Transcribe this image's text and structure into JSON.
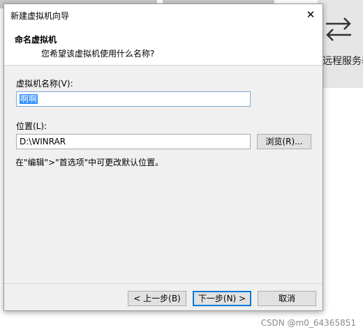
{
  "dialog": {
    "title": "新建虚拟机向导",
    "close_glyph": "✕",
    "header_title": "命名虚拟机",
    "header_subtitle": "您希望该虚拟机使用什么名称?",
    "vm_name_label": "虚拟机名称(V):",
    "vm_name_value": "啊啊",
    "location_label": "位置(L):",
    "location_value": "D:\\WINRAR",
    "browse_label": "浏览(R)...",
    "hint": "在\"编辑\">\"首选项\"中可更改默认位置。",
    "back_label": "< 上一步(B)",
    "next_label": "下一步(N) >",
    "cancel_label": "取消"
  },
  "background": {
    "remote_label": "远程服务器",
    "arrows_icon": "swap-arrows-icon"
  },
  "watermark": "CSDN @m0_64365851"
}
